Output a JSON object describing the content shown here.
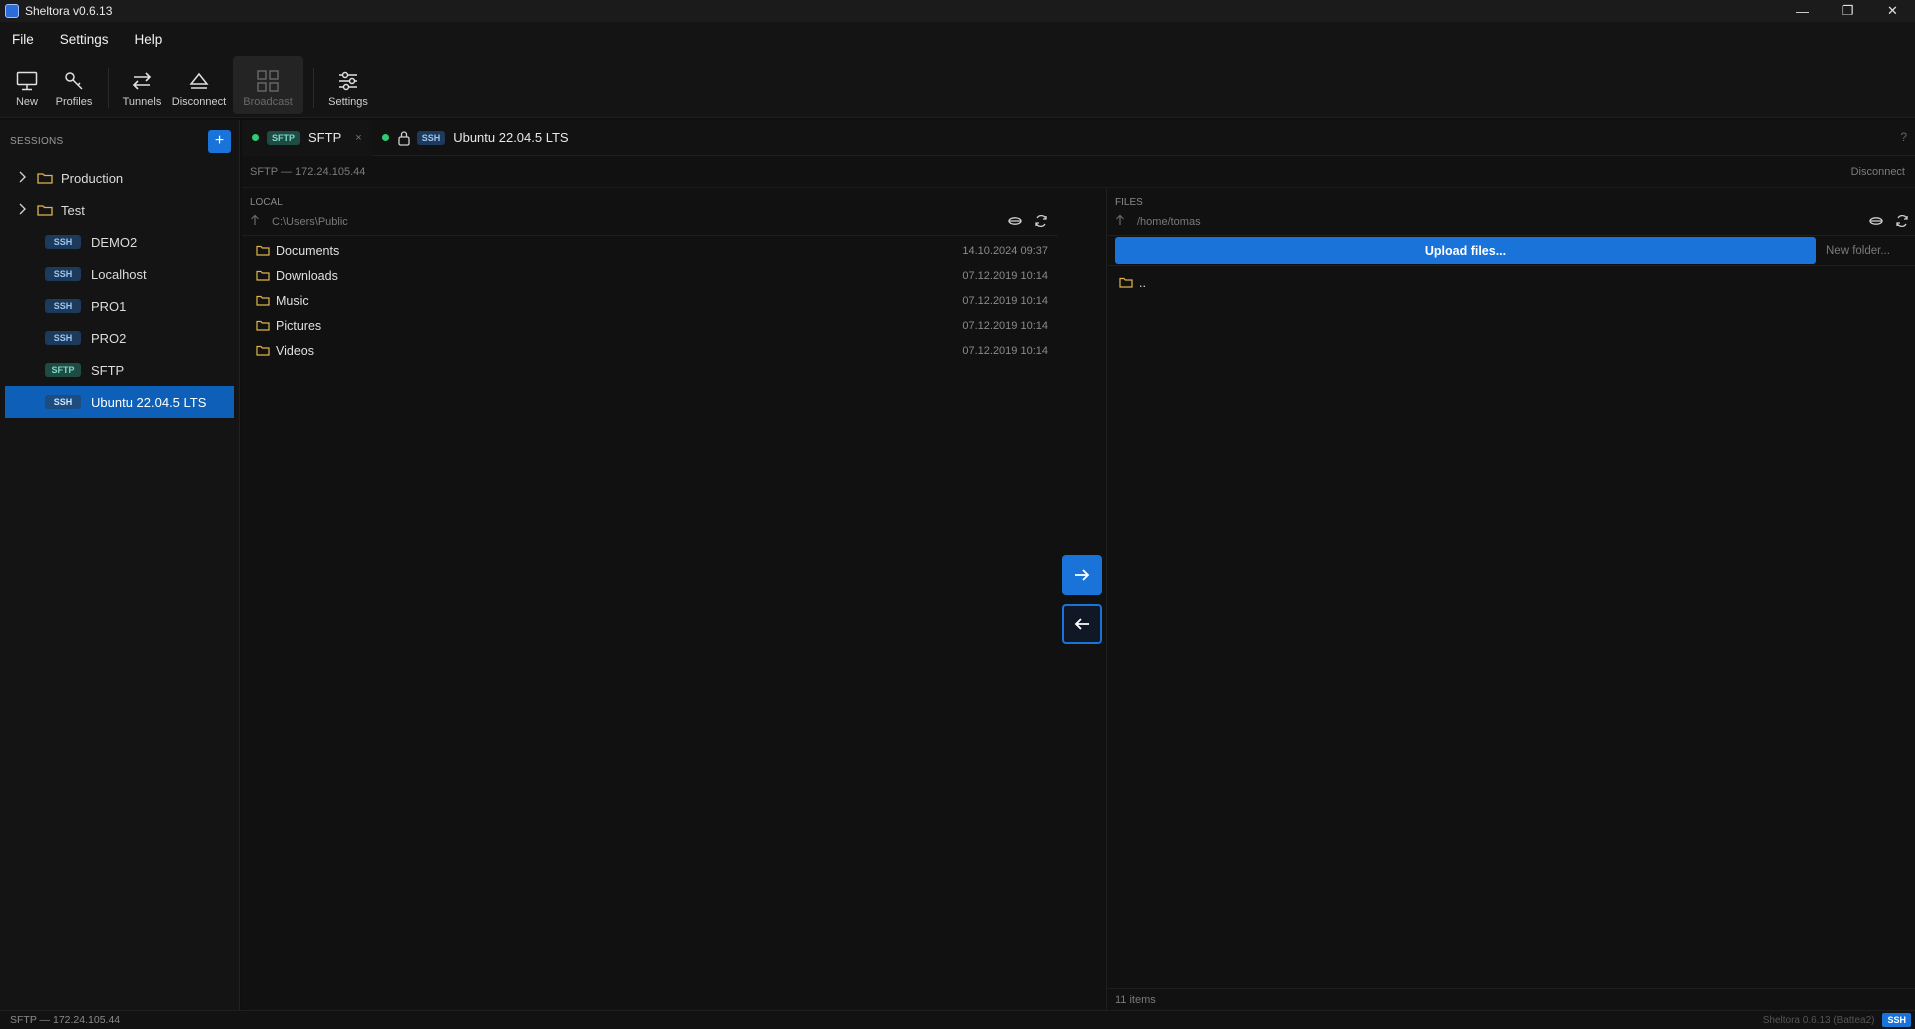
{
  "window": {
    "title": "Sheltora v0.6.13",
    "minimize": "—",
    "restore": "❐",
    "close": "✕"
  },
  "menu": [
    "File",
    "Settings",
    "Help"
  ],
  "toolbar": {
    "new": "New",
    "profiles": "Profiles",
    "tunnels": "Tunnels",
    "disconnect": "Disconnect",
    "broadcast": "Broadcast",
    "settings": "Settings"
  },
  "sidebar": {
    "title": "SESSIONS",
    "add_label": "+",
    "folders": [
      {
        "label": "Production"
      },
      {
        "label": "Test"
      }
    ],
    "sessions": [
      {
        "type": "SSH",
        "label": "DEMO2"
      },
      {
        "type": "SSH",
        "label": "Localhost"
      },
      {
        "type": "SSH",
        "label": "PRO1"
      },
      {
        "type": "SSH",
        "label": "PRO2"
      },
      {
        "type": "SFTP",
        "label": "SFTP"
      },
      {
        "type": "SSH",
        "label": "Ubuntu 22.04.5 LTS",
        "selected": true
      }
    ]
  },
  "tabs": [
    {
      "type": "SFTP",
      "label": "SFTP",
      "close": "×"
    },
    {
      "type": "SSH",
      "label": "Ubuntu 22.04.5 LTS"
    }
  ],
  "help": "?",
  "connection": {
    "subtitle": "SFTP — 172.24.105.44",
    "disconnect": "Disconnect"
  },
  "local": {
    "title": "LOCAL",
    "path": "C:\\Users\\Public",
    "files": [
      {
        "name": "Documents",
        "date": "14.10.2024 09:37"
      },
      {
        "name": "Downloads",
        "date": "07.12.2019 10:14"
      },
      {
        "name": "Music",
        "date": "07.12.2019 10:14"
      },
      {
        "name": "Pictures",
        "date": "07.12.2019 10:14"
      },
      {
        "name": "Videos",
        "date": "07.12.2019 10:14"
      }
    ]
  },
  "remote": {
    "title": "FILES",
    "path": "/home/tomas",
    "upload": "Upload files...",
    "new_folder": "New folder...",
    "files": [
      {
        "name": ".."
      }
    ],
    "footer": "11 items"
  },
  "statusbar": {
    "left": "SFTP — 172.24.105.44",
    "version": "Sheltora 0.6.13 (Battea2)",
    "badge": "SSH"
  },
  "colors": {
    "accent": "#1a73d9",
    "folder": "#e0b54a",
    "online": "#2ecc71",
    "selected": "#0d5fb8"
  }
}
